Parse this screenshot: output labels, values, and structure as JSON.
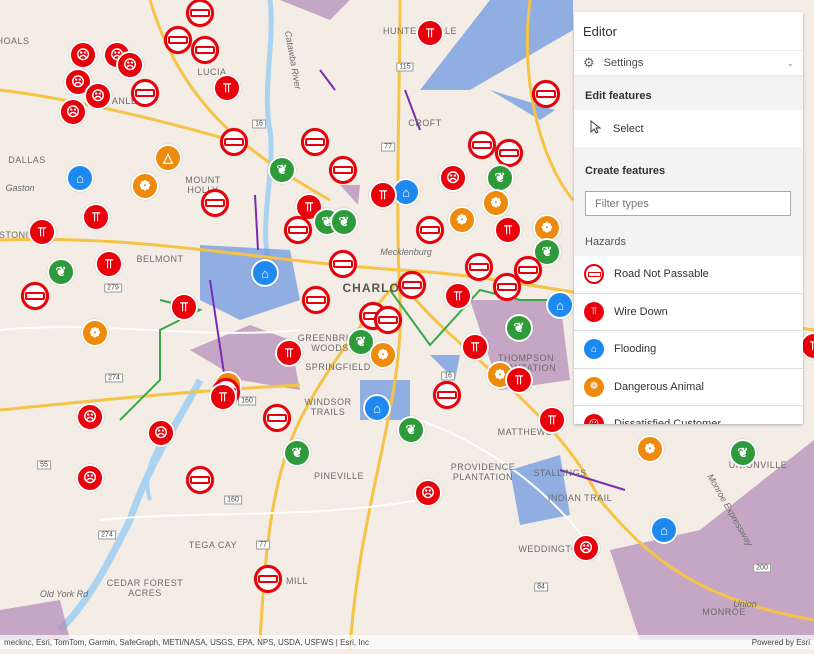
{
  "map": {
    "places": [
      "HUNTERSVILLE",
      "CROFT",
      "DALLAS",
      "Gaston",
      "MOUNT\nHOLLY",
      "LUCIA",
      "HOALS",
      "STANLEY",
      "Mecklenburg",
      "CHARLOTTE",
      "BELMONT",
      "GREENBRIAR\nWOODS",
      "SPRINGFIELD",
      "WINDSOR\nTRAILS",
      "THOMPSON\nPLANTATION",
      "MATTHEWS",
      "PROVIDENCE\nPLANTATION",
      "STALLINGS",
      "INDIAN TRAIL",
      "UNIONVILLE",
      "PINEVILLE",
      "TEGA CAY",
      "CEDAR FOREST\nACRES",
      "Old York Rd",
      "MILL",
      "WEDDINGTON",
      "MONROE",
      "Monroe Expressway",
      "Union",
      "GASTONIA",
      "Catawba River"
    ],
    "routes": [
      "115",
      "16",
      "77",
      "279",
      "274",
      "55",
      "160",
      "274",
      "200",
      "84",
      "16",
      "77",
      "160"
    ],
    "colors": {
      "road_not_passable": "#e8000b",
      "wire_down": "#e8000b",
      "flooding": "#1e8aef",
      "dangerous_animal": "#ee8a0c",
      "vegetation": "#2f9a3a",
      "polygon_purple": "#b58db8",
      "polygon_blue": "#6f98e0"
    }
  },
  "attribution": {
    "left": "mecknc, Esri, TomTom, Garmin, SafeGraph, METI/NASA, USGS, EPA, NPS, USDA, USFWS | Esri, Inc",
    "right": "Powered by Esri"
  },
  "editor": {
    "title": "Editor",
    "settings_label": "Settings",
    "edit_features_heading": "Edit features",
    "select_label": "Select",
    "create_features_heading": "Create features",
    "filter_placeholder": "Filter types",
    "group_heading": "Hazards",
    "items": [
      {
        "label": "Road Not Passable",
        "icon": "road-not-passable-icon"
      },
      {
        "label": "Wire Down",
        "icon": "wire-down-icon"
      },
      {
        "label": "Flooding",
        "icon": "flooding-icon"
      },
      {
        "label": "Dangerous Animal",
        "icon": "dangerous-animal-icon"
      },
      {
        "label": "Dissatisfied Customer",
        "icon": "dissatisfied-customer-icon"
      }
    ]
  }
}
